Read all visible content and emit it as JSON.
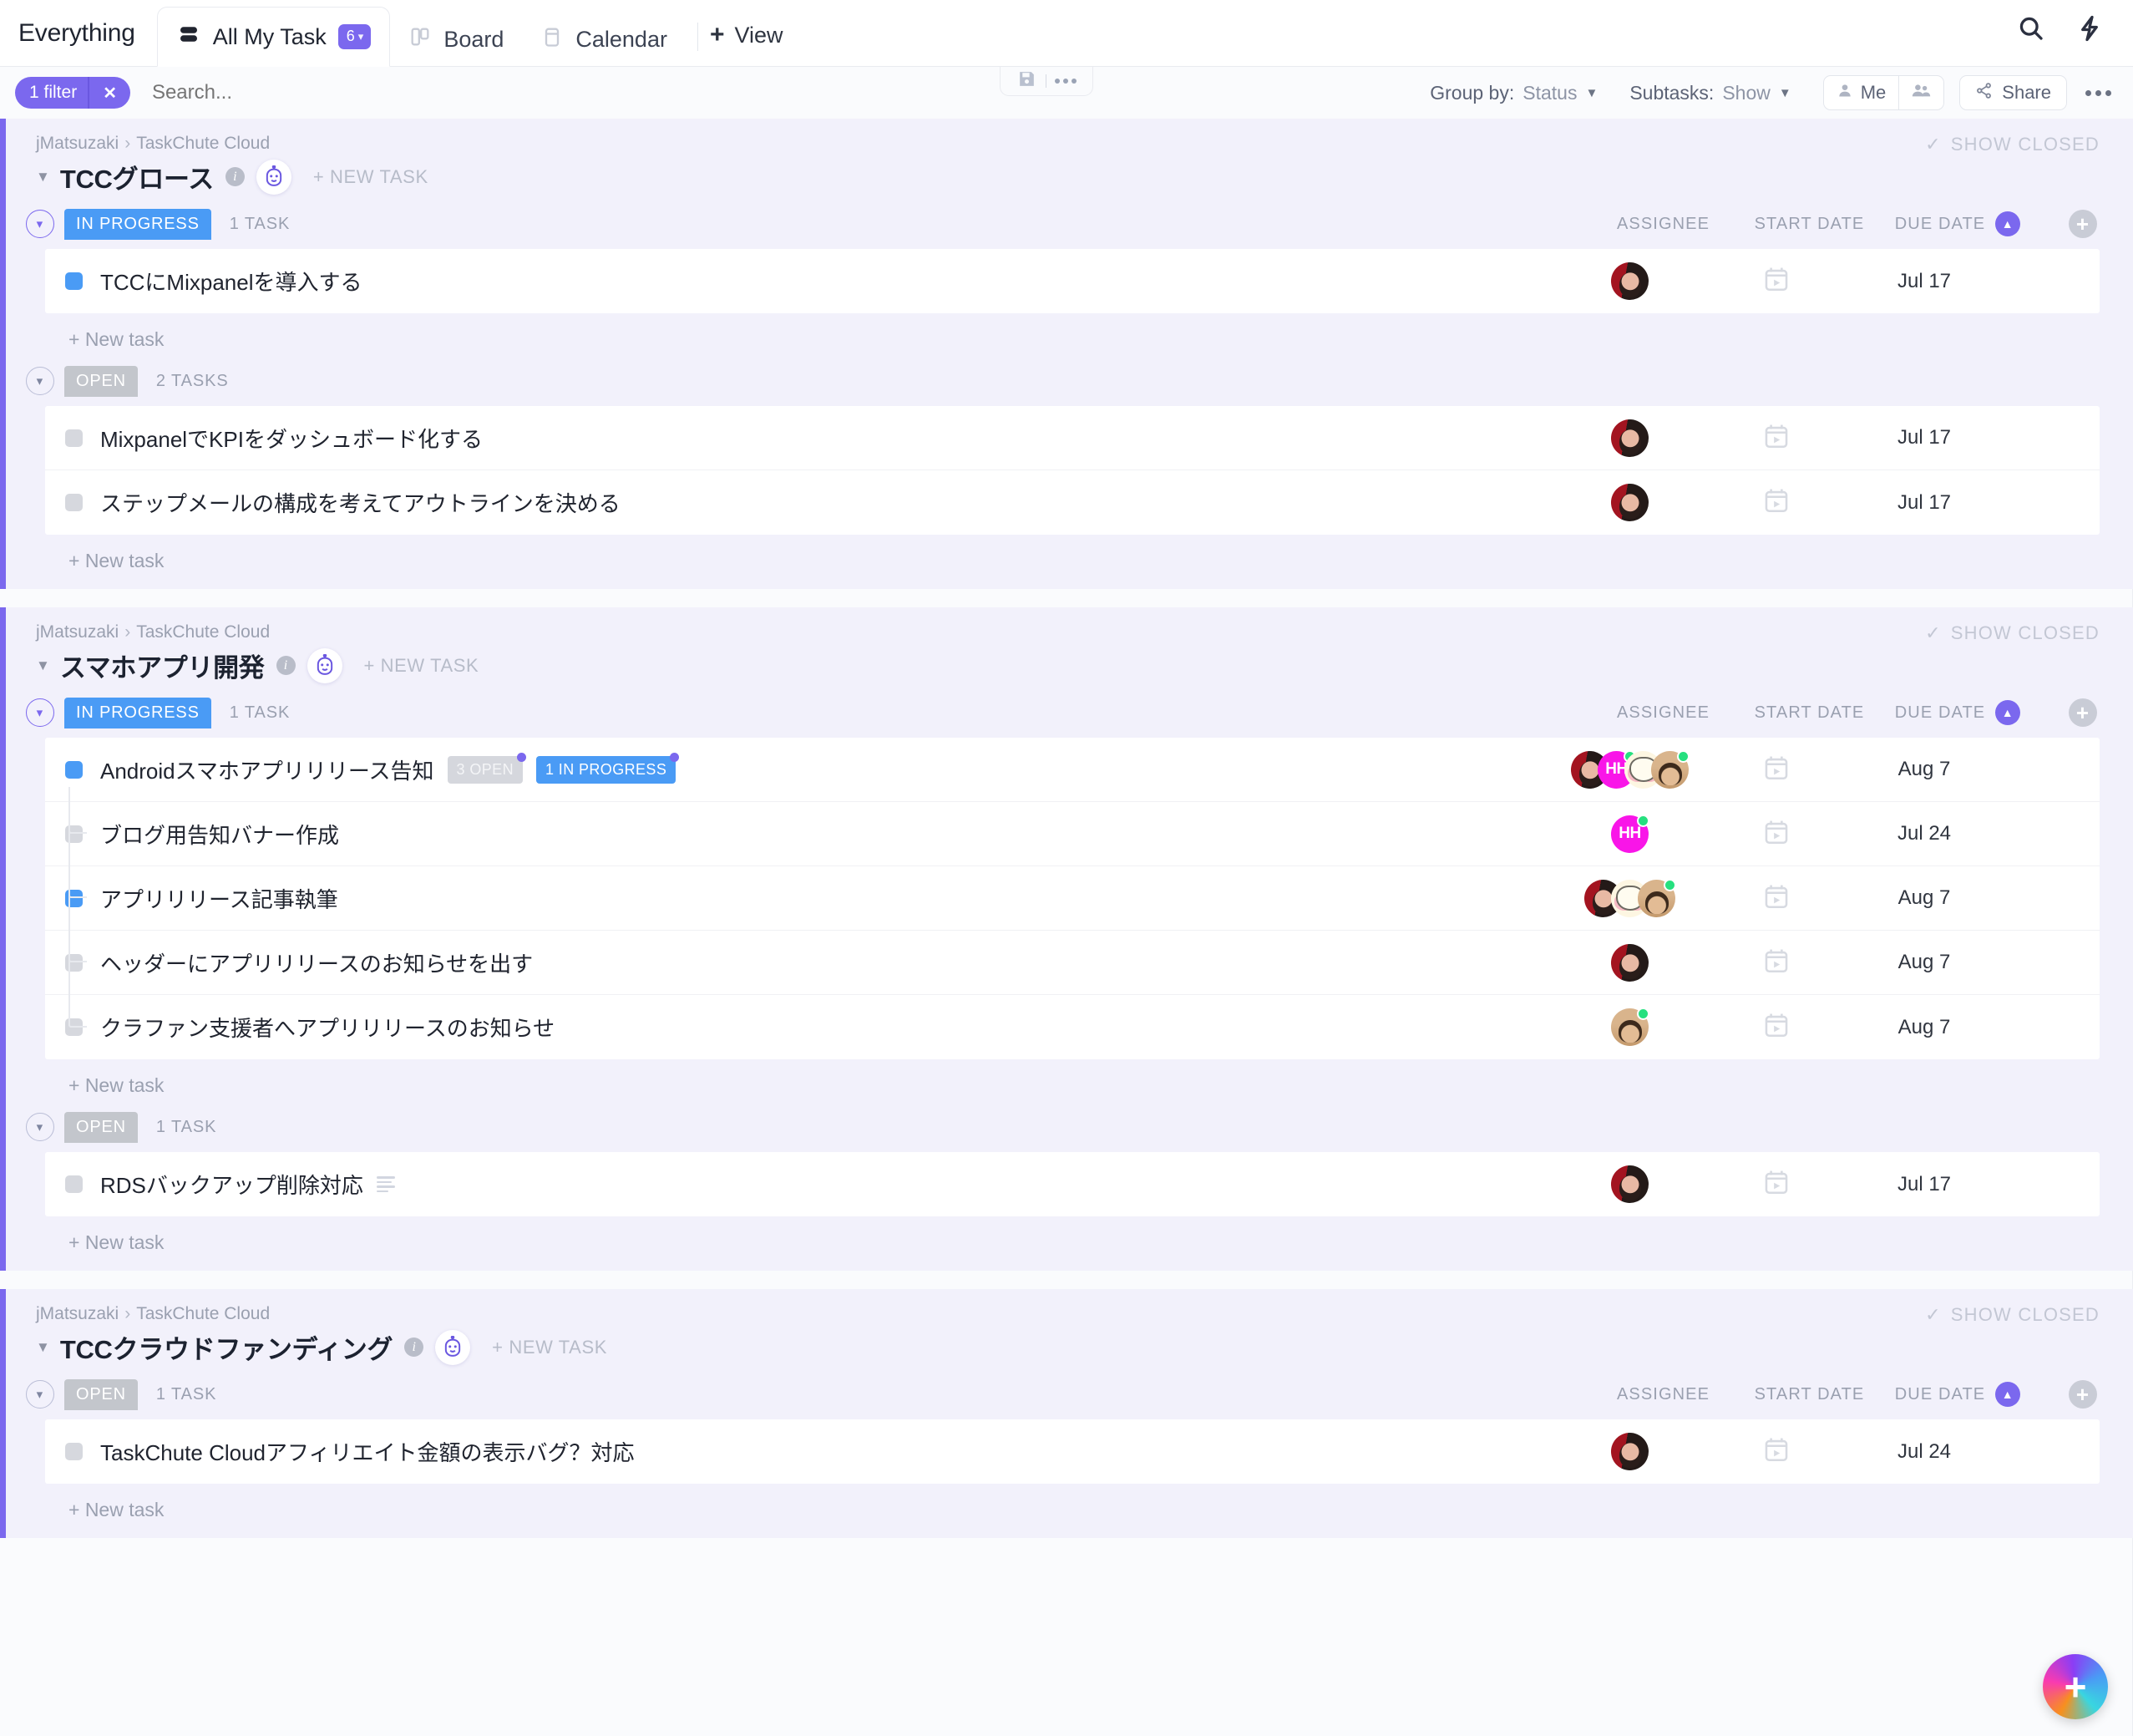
{
  "topbar": {
    "brand": "Everything",
    "tabs": [
      {
        "label": "All My Task",
        "icon": "list-icon",
        "badge": "6",
        "active": true
      },
      {
        "label": "Board",
        "icon": "board-icon",
        "active": false
      },
      {
        "label": "Calendar",
        "icon": "calendar-icon",
        "active": false
      }
    ],
    "add_view": "View",
    "search_icon": "search-icon",
    "lightning_icon": "lightning-icon"
  },
  "savepill": {
    "save_icon": "save-icon",
    "more_icon": "more-horizontal-icon"
  },
  "filterbar": {
    "filter_label": "1 filter",
    "filter_clear": "✕",
    "search_placeholder": "Search...",
    "group_by_label": "Group by:",
    "group_by_value": "Status",
    "subtasks_label": "Subtasks:",
    "subtasks_value": "Show",
    "me_label": "Me",
    "people_icon": "people-icon",
    "share_label": "Share",
    "more_icon": "more-horizontal-icon"
  },
  "columns": {
    "assignee": "ASSIGNEE",
    "start_date": "START DATE",
    "due_date": "DUE DATE"
  },
  "labels": {
    "show_closed": "SHOW CLOSED",
    "new_task_caps": "+ NEW TASK",
    "new_task": "+ New task",
    "breadcrumb_root": "jMatsuzaki",
    "breadcrumb_child": "TaskChute Cloud"
  },
  "colors": {
    "accent": "#7b68ee",
    "in_progress": "#4a9bf5",
    "open": "#c3c6cc",
    "group_bg": "#f2f1fb",
    "online": "#26e07f",
    "hh_avatar": "#f915e8"
  },
  "groups": [
    {
      "title": "TCCグロース",
      "sections": [
        {
          "status": "IN PROGRESS",
          "status_class": "inprog",
          "count": "1 TASK",
          "expanded": true,
          "tasks": [
            {
              "name": "TCCにMixpanelを導入する",
              "square": "blue",
              "due": "Jul 17",
              "assignees": [
                "girl"
              ]
            }
          ]
        },
        {
          "status": "OPEN",
          "status_class": "open",
          "count": "2 TASKS",
          "expanded": false,
          "tasks": [
            {
              "name": "MixpanelでKPIをダッシュボード化する",
              "square": "gray",
              "due": "Jul 17",
              "assignees": [
                "girl"
              ]
            },
            {
              "name": "ステップメールの構成を考えてアウトラインを決める",
              "square": "gray",
              "due": "Jul 17",
              "assignees": [
                "girl"
              ]
            }
          ]
        }
      ]
    },
    {
      "title": "スマホアプリ開発",
      "sections": [
        {
          "status": "IN PROGRESS",
          "status_class": "inprog",
          "count": "1 TASK",
          "expanded": true,
          "tasks": [
            {
              "name": "Androidスマホアプリリリース告知",
              "square": "blue",
              "due": "Aug 7",
              "badges": [
                {
                  "text": "3 OPEN",
                  "kind": "open"
                },
                {
                  "text": "1 IN PROGRESS",
                  "kind": "prog"
                }
              ],
              "assignees": [
                "girl",
                "hh",
                "cat",
                "man"
              ]
            },
            {
              "name": "ブログ用告知バナー作成",
              "square": "gray",
              "due": "Jul 24",
              "sub": true,
              "assignees": [
                "hh"
              ]
            },
            {
              "name": "アプリリリース記事執筆",
              "square": "blue",
              "due": "Aug 7",
              "sub": true,
              "assignees": [
                "girl",
                "cat",
                "man"
              ]
            },
            {
              "name": "ヘッダーにアプリリリースのお知らせを出す",
              "square": "gray",
              "due": "Aug 7",
              "sub": true,
              "assignees": [
                "girl"
              ]
            },
            {
              "name": "クラファン支援者へアプリリリースのお知らせ",
              "square": "gray",
              "due": "Aug 7",
              "sub": true,
              "assignees": [
                "man"
              ]
            }
          ]
        },
        {
          "status": "OPEN",
          "status_class": "open",
          "count": "1 TASK",
          "expanded": false,
          "tasks": [
            {
              "name": "RDSバックアップ削除対応",
              "square": "gray",
              "due": "Jul 17",
              "has_description": true,
              "assignees": [
                "girl"
              ]
            }
          ]
        }
      ]
    },
    {
      "title": "TCCクラウドファンディング",
      "sections": [
        {
          "status": "OPEN",
          "status_class": "open",
          "count": "1 TASK",
          "expanded": false,
          "tasks": [
            {
              "name": "TaskChute Cloudアフィリエイト金額の表示バグ？対応",
              "square": "gray",
              "due": "Jul 24",
              "assignees": [
                "girl"
              ]
            }
          ]
        }
      ]
    }
  ]
}
